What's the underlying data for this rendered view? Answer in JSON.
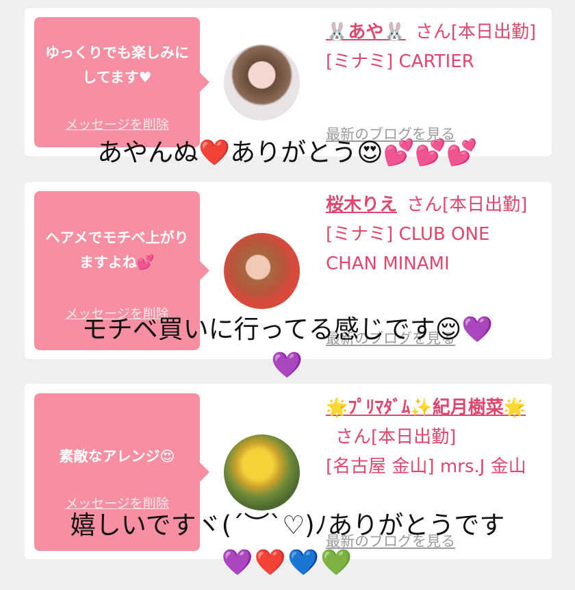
{
  "cards": [
    {
      "message": "ゆっくりでも楽しみにしてます♥",
      "delete_label": "メッセージを削除",
      "name": "🐰あや🐰",
      "suffix": "さん[本日出勤]",
      "shop": "[ミナミ] CARTIER",
      "blog_link": "最新のブログを見る"
    },
    {
      "message": "ヘアメでモチベ上がりますよね💕",
      "delete_label": "メッセージを削除",
      "name": "桜木りえ",
      "suffix": "さん[本日出勤]",
      "shop": "[ミナミ] CLUB ONE CHAN MINAMI",
      "blog_link": "最新のブログを見る"
    },
    {
      "message": "素敵なアレンジ😍",
      "delete_label": "メッセージを削除",
      "name": "🌟ﾌﾟﾘﾏﾀﾞﾑ✨紀月樹菜🌟",
      "suffix": "さん[本日出勤]",
      "shop": "[名古屋 金山] mrs.J 金山",
      "blog_link": "最新のブログを見る"
    }
  ],
  "captions": {
    "c1": "あやんぬ❤️ありがとう😍💕💕💕",
    "c2a": "モチベ買いに行ってる感じです😌💜",
    "c2b": "💜",
    "c3a": "嬉しいですヾ(´︶`♡)ﾉありがとうです",
    "c3b": "💜❤️💙💚"
  },
  "colors": {
    "bubble": "#f78fa2",
    "accent_text": "#e0466c",
    "link_gray": "#9b9b9b",
    "background": "#efefef"
  }
}
